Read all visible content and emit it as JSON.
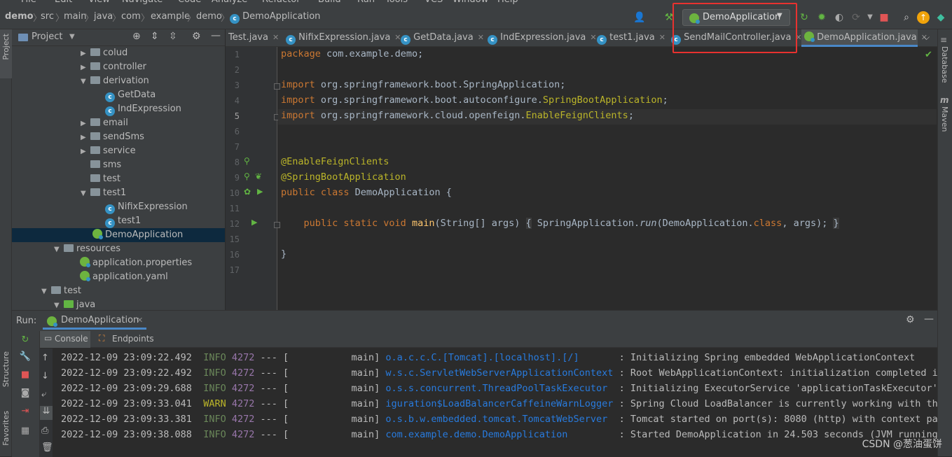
{
  "menubar": {
    "items": [
      "File",
      "Edit",
      "View",
      "Navigate",
      "Code",
      "Analyze",
      "Refactor",
      "Build",
      "Run",
      "Tools",
      "VCS",
      "Window",
      "Help"
    ]
  },
  "breadcrumb": {
    "items": [
      "demo",
      "src",
      "main",
      "java",
      "com",
      "example",
      "demo",
      "DemoApplication"
    ]
  },
  "run_config": {
    "label": "DemoApplication"
  },
  "project_panel": {
    "title": "Project"
  },
  "tree": [
    {
      "label": "colud",
      "type": "folder",
      "expanded": false
    },
    {
      "label": "controller",
      "type": "folder",
      "expanded": false
    },
    {
      "label": "derivation",
      "type": "folder",
      "expanded": true
    },
    {
      "label": "GetData",
      "type": "class"
    },
    {
      "label": "IndExpression",
      "type": "class"
    },
    {
      "label": "email",
      "type": "folder",
      "expanded": false
    },
    {
      "label": "sendSms",
      "type": "folder",
      "expanded": false
    },
    {
      "label": "service",
      "type": "folder",
      "expanded": false
    },
    {
      "label": "sms",
      "type": "folder"
    },
    {
      "label": "test",
      "type": "folder"
    },
    {
      "label": "test1",
      "type": "folder",
      "expanded": true
    },
    {
      "label": "NifixExpression",
      "type": "class"
    },
    {
      "label": "test1",
      "type": "class"
    },
    {
      "label": "DemoApplication",
      "type": "spring",
      "selected": true
    },
    {
      "label": "resources",
      "type": "folder",
      "expanded": true
    },
    {
      "label": "application.properties",
      "type": "config"
    },
    {
      "label": "application.yaml",
      "type": "config"
    },
    {
      "label": "test",
      "type": "folder",
      "expanded": true
    },
    {
      "label": "java",
      "type": "folder-green",
      "expanded": true
    }
  ],
  "tabs": [
    {
      "label": "Test.java"
    },
    {
      "label": "NifixExpression.java"
    },
    {
      "label": "GetData.java"
    },
    {
      "label": "IndExpression.java"
    },
    {
      "label": "test1.java"
    },
    {
      "label": "SendMailController.java"
    },
    {
      "label": "DemoApplication.java",
      "active": true
    }
  ],
  "editor": {
    "line_numbers": [
      "1",
      "2",
      "3",
      "4",
      "5",
      "6",
      "7",
      "8",
      "9",
      "10",
      "11",
      "12",
      "15",
      "16",
      "17"
    ],
    "current_line": "5",
    "lines": [
      [
        "package com.example.demo;"
      ],
      [
        ""
      ],
      [
        "import org.springframework.boot.SpringApplication;"
      ],
      [
        "import org.springframework.boot.autoconfigure.SpringBootApplication;"
      ],
      [
        "import org.springframework.cloud.openfeign.EnableFeignClients;"
      ],
      [
        ""
      ],
      [
        ""
      ],
      [
        "@EnableFeignClients"
      ],
      [
        "@SpringBootApplication"
      ],
      [
        "public class DemoApplication {"
      ],
      [
        ""
      ],
      [
        "    public static void main(String[] args) { SpringApplication.run(DemoApplication.class, args); }"
      ],
      [
        ""
      ],
      [
        "}"
      ],
      [
        ""
      ]
    ]
  },
  "right_strip": {
    "database": "Database",
    "maven": "Maven"
  },
  "left_strip": {
    "project": "Project",
    "structure": "Structure",
    "favorites": "Favorites"
  },
  "run": {
    "label": "Run:",
    "config": "DemoApplication",
    "tabs": [
      "Console",
      "Endpoints"
    ],
    "log": [
      {
        "ts": "2022-12-09 23:09:22.492",
        "level": "INFO",
        "pid": "4272",
        "thread": "main",
        "logger": "o.a.c.c.C.[Tomcat].[localhost].[/]",
        "msg": "Initializing Spring embedded WebApplicationContext"
      },
      {
        "ts": "2022-12-09 23:09:22.492",
        "level": "INFO",
        "pid": "4272",
        "thread": "main",
        "logger": "w.s.c.ServletWebServerApplicationContext",
        "msg": "Root WebApplicationContext: initialization completed in 4"
      },
      {
        "ts": "2022-12-09 23:09:29.688",
        "level": "INFO",
        "pid": "4272",
        "thread": "main",
        "logger": "o.s.s.concurrent.ThreadPoolTaskExecutor",
        "msg": "Initializing ExecutorService 'applicationTaskExecutor'"
      },
      {
        "ts": "2022-12-09 23:09:33.041",
        "level": "WARN",
        "pid": "4272",
        "thread": "main",
        "logger": "iguration$LoadBalancerCaffeineWarnLogger",
        "msg": "Spring Cloud LoadBalancer is currently working with the d"
      },
      {
        "ts": "2022-12-09 23:09:33.381",
        "level": "INFO",
        "pid": "4272",
        "thread": "main",
        "logger": "o.s.b.w.embedded.tomcat.TomcatWebServer",
        "msg": "Tomcat started on port(s): 8080 (http) with context path"
      },
      {
        "ts": "2022-12-09 23:09:38.088",
        "level": "INFO",
        "pid": "4272",
        "thread": "main",
        "logger": "com.example.demo.DemoApplication",
        "msg": "Started DemoApplication in 24.503 seconds (JVM running fo"
      }
    ]
  },
  "watermark": "CSDN @葱油蛋饼",
  "colors": {
    "highlight_box": "#e8322f",
    "selection": "#0d293e",
    "keyword": "#cc7832",
    "annotation": "#bbb529",
    "logger": "#287bde"
  }
}
